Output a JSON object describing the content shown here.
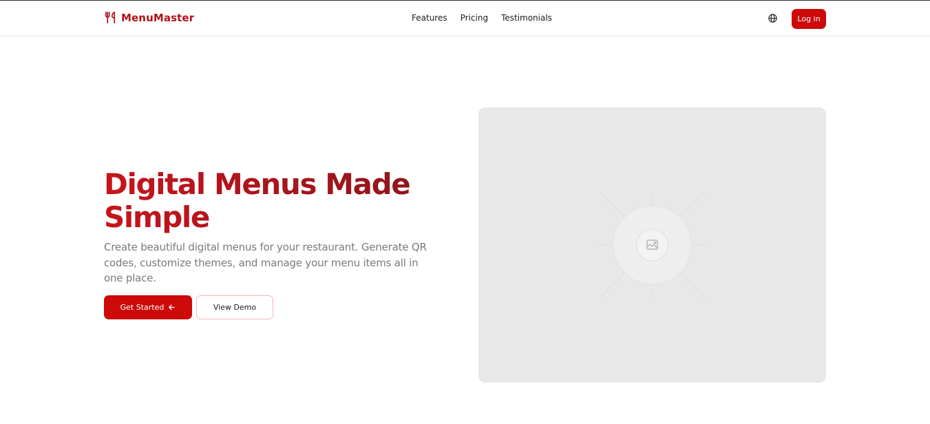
{
  "header": {
    "brand_name": "MenuMaster",
    "brand_icon": "utensils-icon",
    "nav": [
      {
        "label": "Features"
      },
      {
        "label": "Pricing"
      },
      {
        "label": "Testimonials"
      }
    ],
    "language_icon": "globe-icon",
    "login_label": "Log in"
  },
  "hero": {
    "title_line1": "Digital Menus Made",
    "title_line2": "Simple",
    "subtitle": "Create beautiful digital menus for your restaurant. Generate QR codes, customize themes, and manage your menu items all in one place.",
    "primary_cta": "Get Started",
    "primary_cta_icon": "arrow-left-icon",
    "secondary_cta": "View Demo",
    "image_icon": "image-placeholder-icon"
  },
  "colors": {
    "brand": "#b3121b",
    "accent": "#cc0a0a",
    "muted_text": "#7a7a7a",
    "placeholder_bg": "#e8e8e8"
  }
}
